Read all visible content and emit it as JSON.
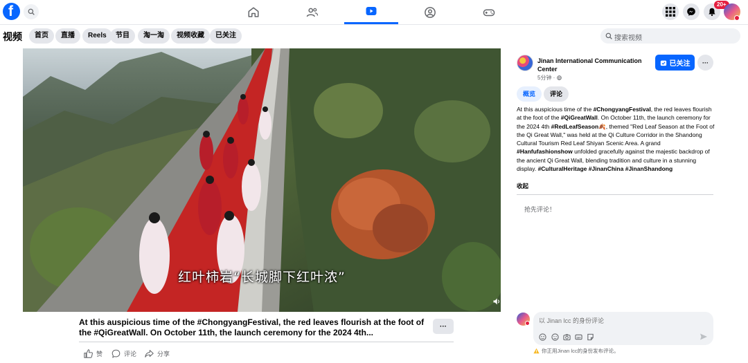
{
  "topnav": {
    "logo": "f",
    "notification_count": "20+",
    "active_tab": "video"
  },
  "subnav": {
    "title": "视频",
    "chips": [
      "首页",
      "直播",
      "Reels",
      "节目",
      "淘一淘",
      "视频收藏",
      "已关注"
    ],
    "search_placeholder": "搜索视频"
  },
  "video": {
    "subtitle": "红叶柿岩“长城脚下红叶浓”",
    "caption": "At this auspicious time of the #ChongyangFestival, the red leaves flourish at the foot of the #QiGreatWall. On October 11th, the launch ceremony for the 2024 4th...",
    "more_label": "···",
    "actions": {
      "like": "赞",
      "comment": "评论",
      "share": "分享"
    }
  },
  "panel": {
    "page_name": "Jinan International Communication Center",
    "time": "5分钟 · ",
    "follow_label": "已关注",
    "more_label": "···",
    "tabs": [
      "概览",
      "评论"
    ],
    "desc": {
      "p1": "At this auspicious time of the ",
      "h1": "#ChongyangFestival",
      "p2": ", the red leaves flourish at the foot of the ",
      "h2": "#QiGreatWall",
      "p3": ". On October 11th, the launch ceremony for the 2024 4th ",
      "h3": "#RedLeafSeason",
      "p4": "🍂, themed \"Red Leaf Season at the Foot of the Qi Great Wall,\" was held at the Qi Culture Corridor in the Shandong Cultural Tourism Red Leaf Shiyan Scenic Area. A grand ",
      "h4": "#Hanfufashionshow",
      "p5": " unfolded gracefully against the majestic backdrop of the ancient Qi Great Wall, blending tradition and culture in a stunning display. ",
      "h5": "#CulturalHeritage",
      "h6": "#JinanChina",
      "h7": "#JinanShandong"
    },
    "collapse_label": "收起",
    "first_comment": "抢先评论！",
    "comment_placeholder": "以 Jinan lcc 的身份评论",
    "warning": "你正用Jinan lcc的身份发布评论。"
  }
}
